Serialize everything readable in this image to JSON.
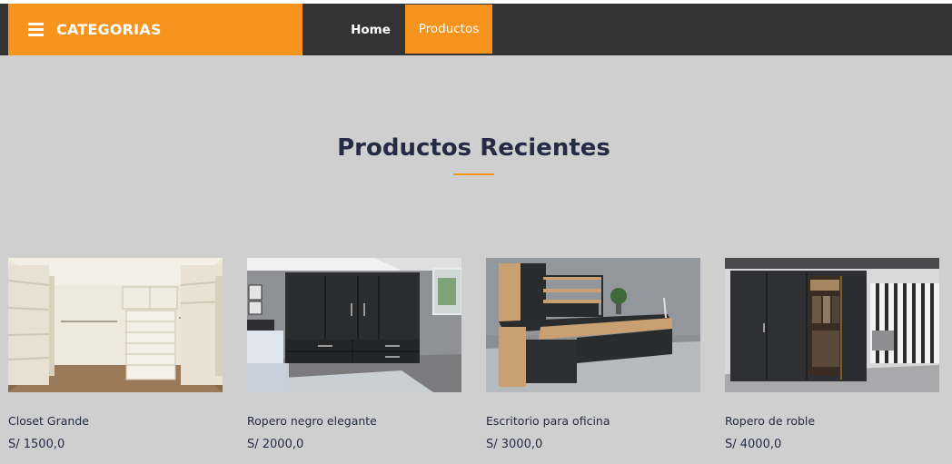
{
  "nav": {
    "categories_label": "CATEGORIAS",
    "links": [
      {
        "label": "Home"
      },
      {
        "label": "Productos"
      }
    ]
  },
  "section": {
    "title": "Productos Recientes"
  },
  "products": [
    {
      "name": "Closet Grande",
      "price": "S/ 1500,0"
    },
    {
      "name": "Ropero negro elegante",
      "price": "S/ 2000,0"
    },
    {
      "name": "Escritorio para oficina",
      "price": "S/ 3000,0"
    },
    {
      "name": "Ropero de roble",
      "price": "S/ 4000,0"
    }
  ],
  "colors": {
    "accent": "#f7941d",
    "navbar": "#333333",
    "background": "#cfcfcf",
    "text_dark": "#252b42"
  }
}
